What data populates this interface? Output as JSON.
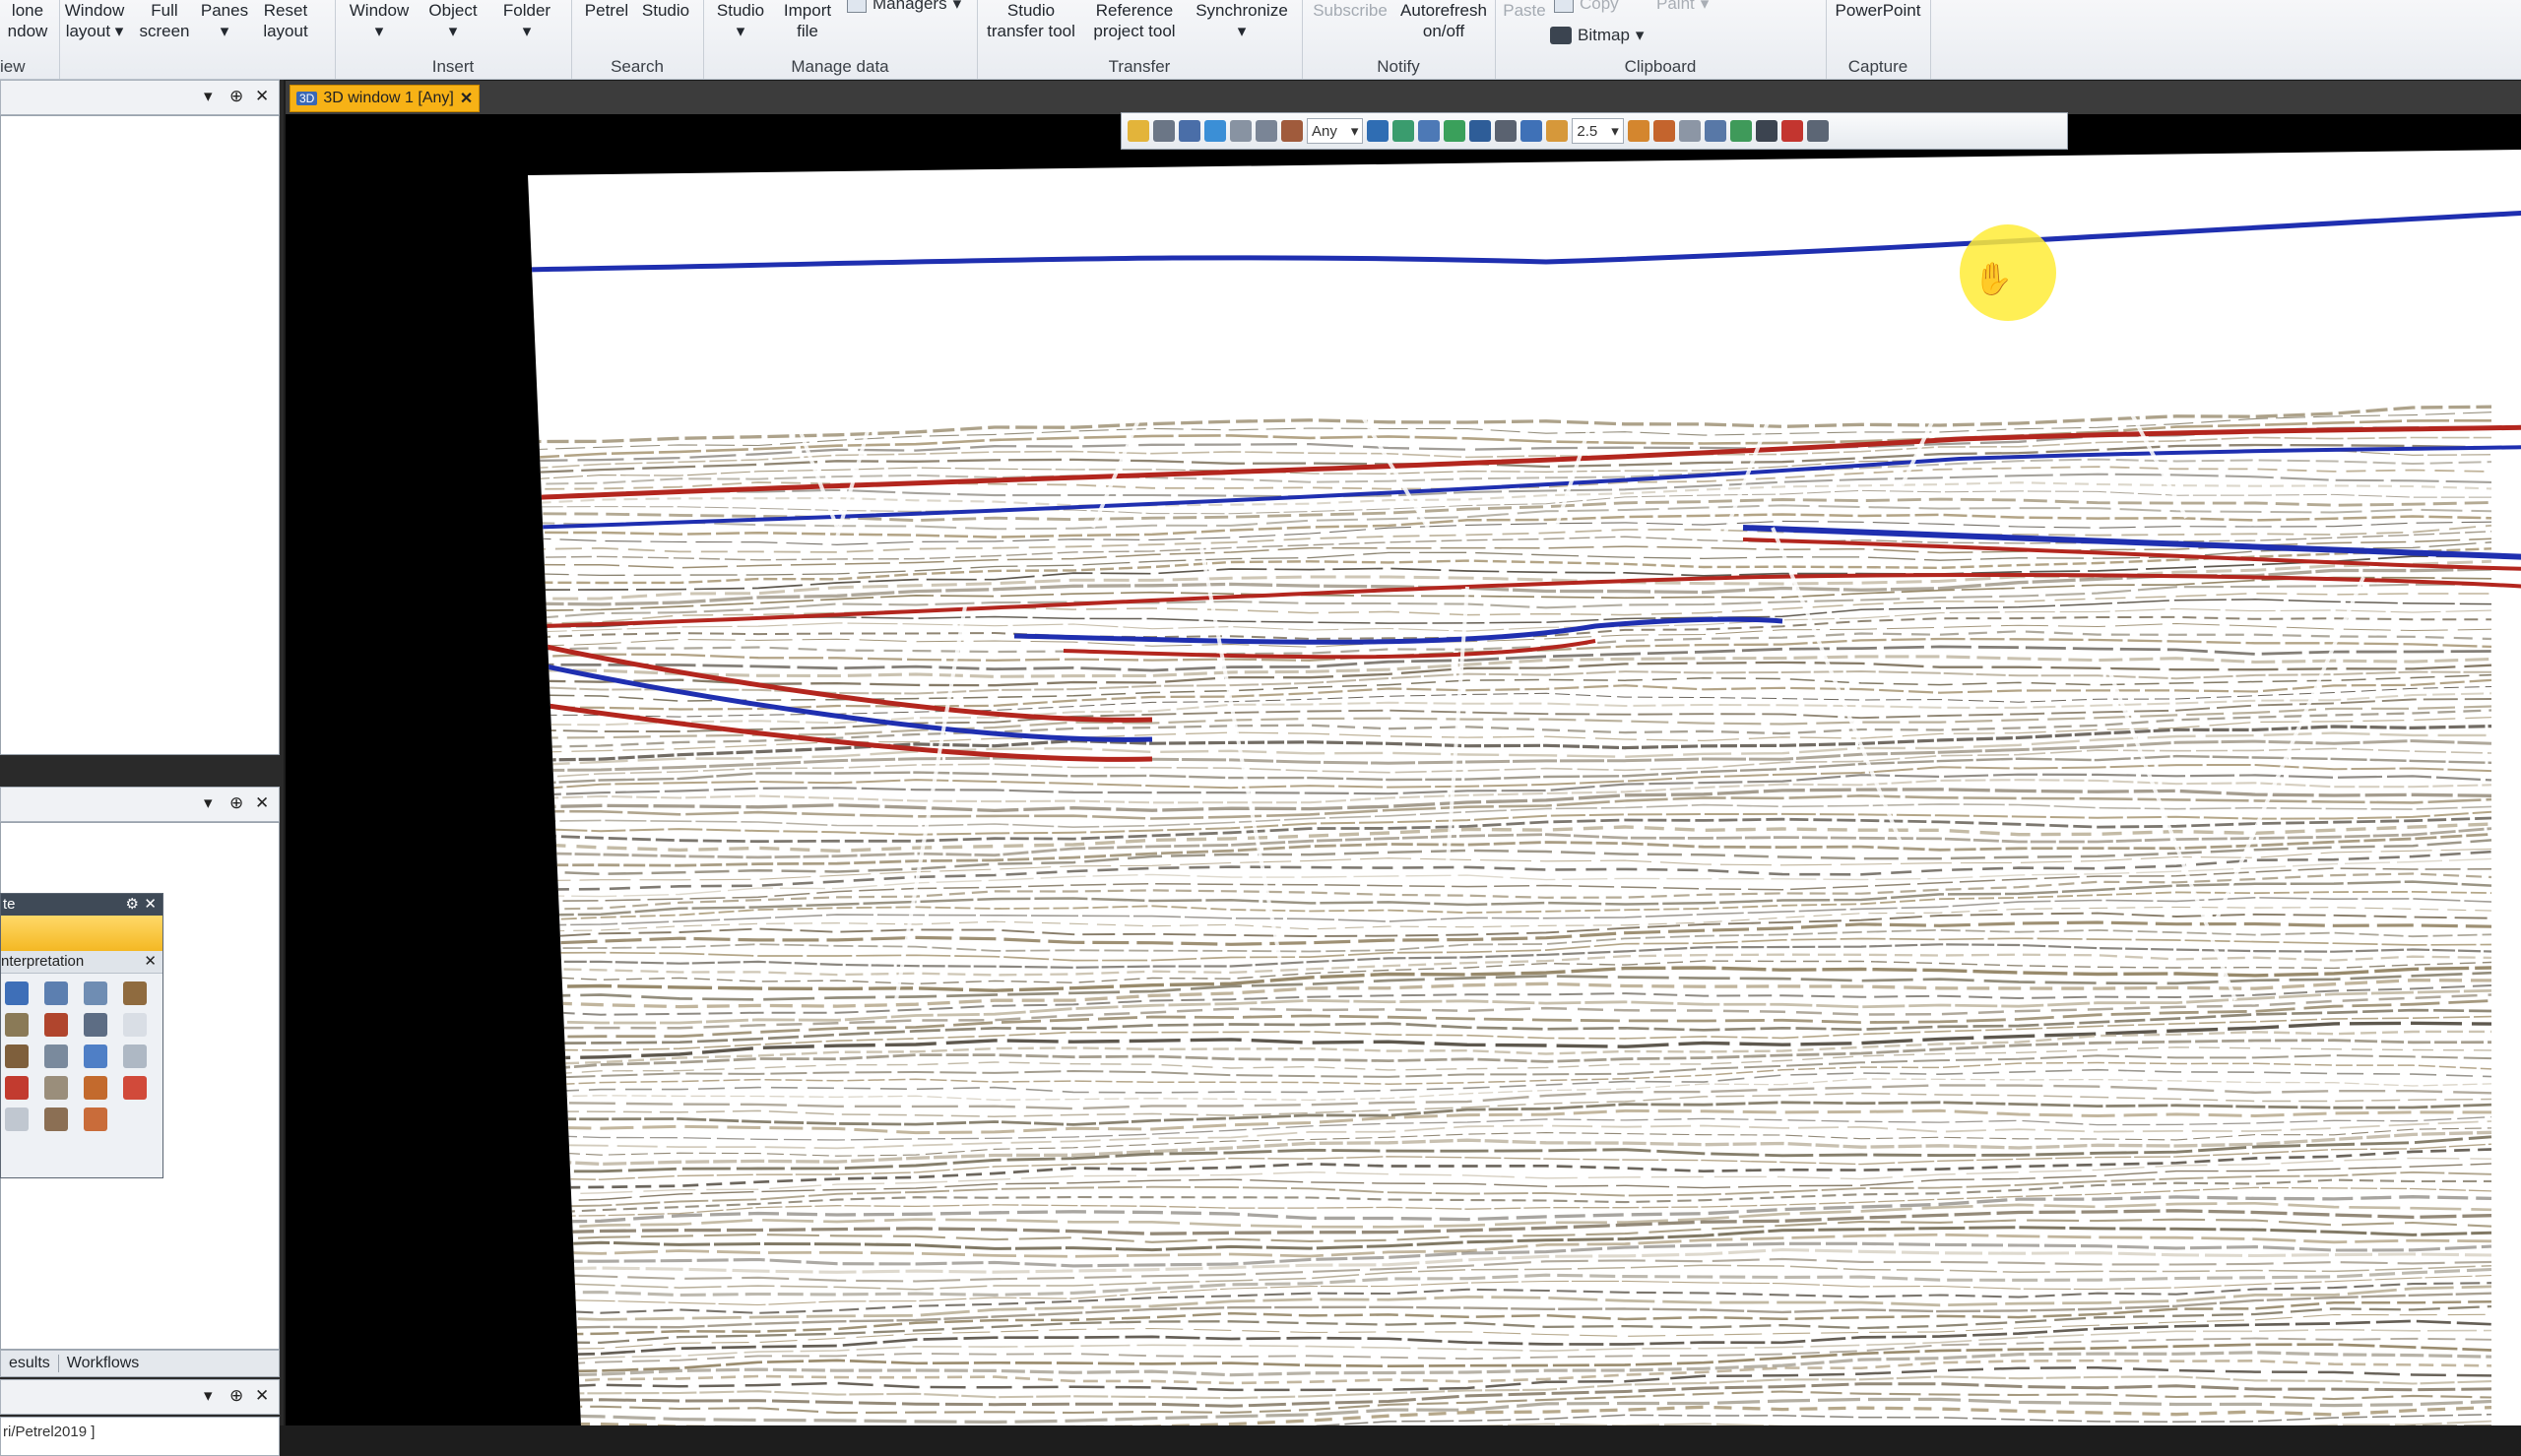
{
  "ribbon": {
    "groups": [
      {
        "label": "iew",
        "buttons": [
          {
            "label": "lone\nndow"
          }
        ]
      },
      {
        "label": "",
        "buttons": [
          {
            "label": "Window\nlayout ▾"
          },
          {
            "label": "Full\nscreen"
          },
          {
            "label": "Panes\n▾"
          },
          {
            "label": "Reset\nlayout"
          }
        ]
      },
      {
        "label": "Insert",
        "buttons": [
          {
            "label": "Window\n▾"
          },
          {
            "label": "Object\n▾"
          },
          {
            "label": "Folder\n▾"
          }
        ]
      },
      {
        "label": "Search",
        "buttons": [
          {
            "label": "Petrel"
          },
          {
            "label": "Studio"
          }
        ]
      },
      {
        "label": "Manage data",
        "buttons": [
          {
            "label": "Studio\n▾"
          },
          {
            "label": "Import\nfile"
          }
        ],
        "small": "Managers"
      },
      {
        "label": "Transfer",
        "buttons": [
          {
            "label": "Studio\ntransfer tool"
          },
          {
            "label": "Reference\nproject tool"
          },
          {
            "label": "Synchronize\n▾"
          }
        ]
      },
      {
        "label": "Notify",
        "buttons": [
          {
            "label": "Subscribe"
          },
          {
            "label": "Autorefresh\non/off"
          }
        ]
      },
      {
        "label": "Clipboard",
        "buttons": [
          {
            "label": "Paste"
          }
        ],
        "copy": "Copy",
        "paint": "Paint",
        "bitmap": "Bitmap"
      },
      {
        "label": "Capture",
        "buttons": [
          {
            "label": "PowerPoint"
          }
        ]
      }
    ]
  },
  "left_dock": {
    "palette_title": "te",
    "palette_sub": "nterpretation",
    "tabs": [
      "esults",
      "Workflows"
    ],
    "status_text": "ri/Petrel2019 ]"
  },
  "document": {
    "tab_badge": "3D",
    "tab_label": "3D window 1 [Any]",
    "toolbar_select": "Any",
    "toolbar_zoom": "2.5"
  },
  "colors": {
    "accent_tab": "#f7b216",
    "horizon_blue": "#1f2fb0",
    "horizon_red": "#b3261e",
    "cursor_highlight": "#ffec37"
  },
  "icons": [
    "pin-icon",
    "close-icon",
    "dropdown-icon",
    "hand-cursor-icon",
    "camera-icon"
  ]
}
